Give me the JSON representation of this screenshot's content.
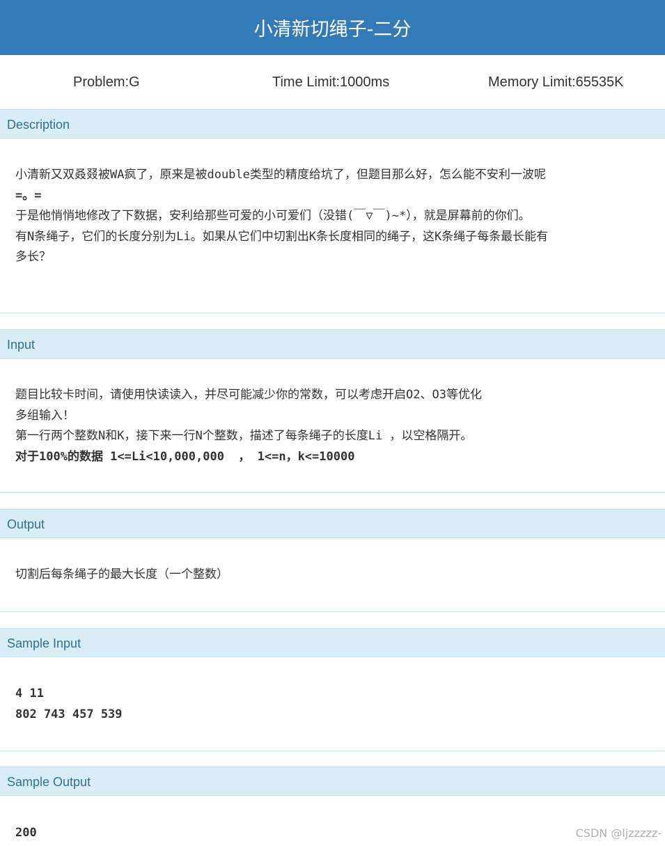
{
  "title": "小清新切绳子-二分",
  "meta": {
    "problem": "Problem:G",
    "time_limit": "Time Limit:1000ms",
    "memory_limit": "Memory Limit:65535K"
  },
  "sections": {
    "description": {
      "heading": "Description",
      "lines": [
        "小清新又双叒叕被WA疯了，原来是被double类型的精度给坑了，但题目那么好，怎么能不安利一波呢",
        "=。=",
        "于是他悄悄地修改了下数据，安利给那些可爱的小可爱们（没错(￣▽￣)~*），就是屏幕前的你们。",
        "有N条绳子，它们的长度分别为Li。如果从它们中切割出K条长度相同的绳子，这K条绳子每条最长能有",
        "多长？"
      ]
    },
    "input": {
      "heading": "Input",
      "lines": [
        "题目比较卡时间，请使用快读读入，并尽可能减少你的常数，可以考虑开启O2、O3等优化",
        "多组输入！",
        "第一行两个整数N和K，接下来一行N个整数，描述了每条绳子的长度Li ，以空格隔开。",
        "对于100%的数据 1<=Li<10,000,000  ， 1<=n，k<=10000"
      ]
    },
    "output": {
      "heading": "Output",
      "lines": [
        "切割后每条绳子的最大长度（一个整数）"
      ]
    },
    "sample_input": {
      "heading": "Sample Input",
      "lines": [
        "4 11",
        "802 743 457 539"
      ]
    },
    "sample_output": {
      "heading": "Sample Output",
      "lines": [
        "200"
      ]
    }
  },
  "watermark": "CSDN @ljzzzzz-"
}
